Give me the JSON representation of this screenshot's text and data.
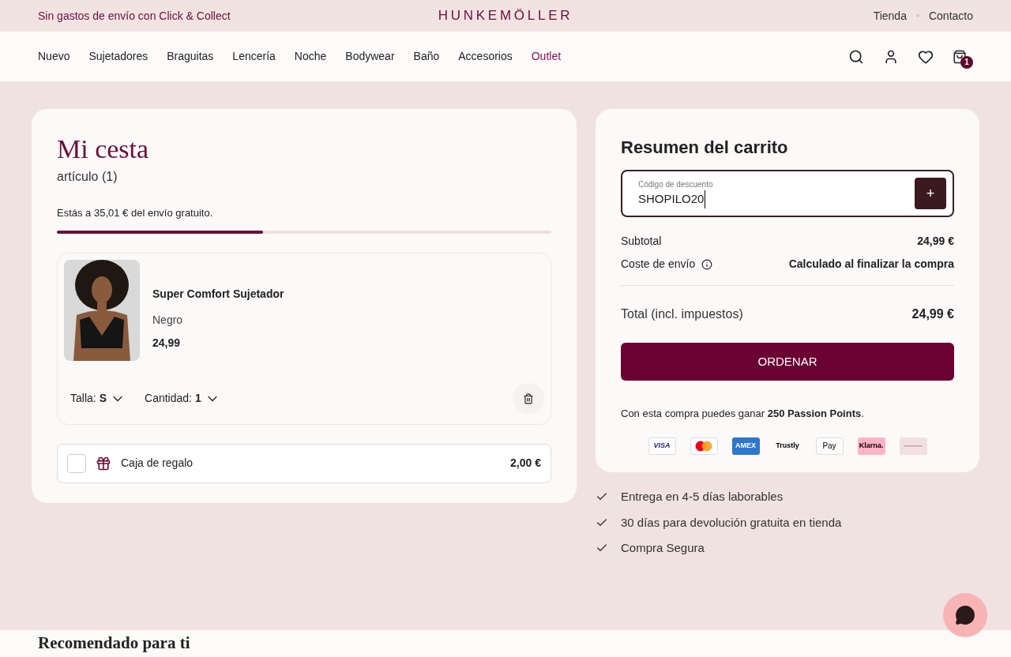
{
  "promo_bar": {
    "message": "Sin gastos de envío con Click & Collect",
    "logo": "HUNKEMÖLLER",
    "links": [
      "Tienda",
      "Contacto"
    ]
  },
  "nav": {
    "items": [
      {
        "label": "Nuevo",
        "kind": "normal"
      },
      {
        "label": "Sujetadores",
        "kind": "normal"
      },
      {
        "label": "Braguitas",
        "kind": "normal"
      },
      {
        "label": "Lencería",
        "kind": "normal"
      },
      {
        "label": "Noche",
        "kind": "normal"
      },
      {
        "label": "Bodywear",
        "kind": "normal"
      },
      {
        "label": "Baño",
        "kind": "normal"
      },
      {
        "label": "Accesorios",
        "kind": "normal"
      },
      {
        "label": "Outlet",
        "kind": "highlight"
      }
    ],
    "cart_count": "1"
  },
  "cart": {
    "title": "Mi cesta",
    "count": "artículo (1)",
    "shipping_message": "Estás a 35,01 € del envío gratuito.",
    "shipping_progress": {
      "level": 0.417
    },
    "item": {
      "kind": "picture",
      "name": "Super Comfort Sujetador",
      "variant": "Negro",
      "price": "24,99",
      "size_label": "Talla:",
      "size": "S",
      "qty_label": "Cantidad:",
      "qty": "1"
    },
    "gift_box": {
      "label": "Caja de regalo",
      "price": "2,00 €",
      "checked": false
    }
  },
  "summary": {
    "title": "Resumen del carrito",
    "discount": {
      "label": "Código de descuento",
      "value": "SHOPILO20",
      "button": "+"
    },
    "rows": [
      {
        "label": "Subtotal",
        "value": "24,99 €",
        "info": false
      },
      {
        "label": "Coste de envío",
        "value": "Calculado al finalizar la compra",
        "info": true
      }
    ],
    "total_label": "Total (incl. impuestos)",
    "total": "24,99 €",
    "order_button": "ORDENAR",
    "points": "Con esta compra puedes ganar **250 Passion Points**.",
    "payments": [
      {
        "kind": "visa",
        "label": "VISA"
      },
      {
        "kind": "mastercard"
      },
      {
        "kind": "amex",
        "label": "AMEX"
      },
      {
        "kind": "trustly",
        "label": "Trustly"
      },
      {
        "kind": "applepay",
        "label": "Pay"
      },
      {
        "kind": "klarna",
        "label": "Klarna."
      },
      {
        "kind": "giftcard"
      }
    ]
  },
  "benefits": [
    "Entrega en 4-5 días laborables",
    "30 días para devolución gratuita en tienda",
    "Compra Segura"
  ],
  "recommended": {
    "title": "Recomendado para ti"
  }
}
